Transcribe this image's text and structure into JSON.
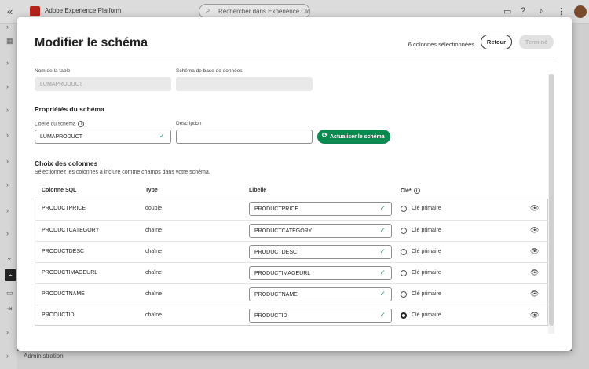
{
  "app": {
    "title": "Adobe Experience Platform",
    "search_placeholder": "Rechercher dans Experience Clou..."
  },
  "background": {
    "admin_label": "Administration"
  },
  "modal": {
    "title": "Modifier le schéma",
    "selected_count": "6 colonnes sélectionnées",
    "back_label": "Retour",
    "done_label": "Terminé",
    "table_name_label": "Nom de la table",
    "table_name_value": "LUMAPRODUCT",
    "db_schema_label": "Schéma de base de données",
    "db_schema_value": "",
    "schema_props_title": "Propriétés du schéma",
    "schema_label_label": "Libellé du schéma",
    "schema_label_value": "LUMAPRODUCT",
    "description_label": "Description",
    "description_value": "",
    "refresh_label": "Actualiser le schéma",
    "columns_title": "Choix des colonnes",
    "columns_desc": "Sélectionnez les colonnes à inclure comme champs dans votre schéma.",
    "headers": {
      "sql": "Colonne SQL",
      "type": "Type",
      "label": "Libellé",
      "key": "Clé*"
    },
    "primary_key_label": "Clé primaire",
    "rows": [
      {
        "sql": "PRODUCTPRICE",
        "type": "double",
        "label": "PRODUCTPRICE",
        "primary": false
      },
      {
        "sql": "PRODUCTCATEGORY",
        "type": "chaîne",
        "label": "PRODUCTCATEGORY",
        "primary": false
      },
      {
        "sql": "PRODUCTDESC",
        "type": "chaîne",
        "label": "PRODUCTDESC",
        "primary": false
      },
      {
        "sql": "PRODUCTIMAGEURL",
        "type": "chaîne",
        "label": "PRODUCTIMAGEURL",
        "primary": false
      },
      {
        "sql": "PRODUCTNAME",
        "type": "chaîne",
        "label": "PRODUCTNAME",
        "primary": false
      },
      {
        "sql": "PRODUCTID",
        "type": "chaîne",
        "label": "PRODUCTID",
        "primary": true
      }
    ]
  },
  "colors": {
    "accent_green": "#0a8a4e",
    "check_green": "#2d9d78",
    "adobe_red": "#b4241c"
  }
}
